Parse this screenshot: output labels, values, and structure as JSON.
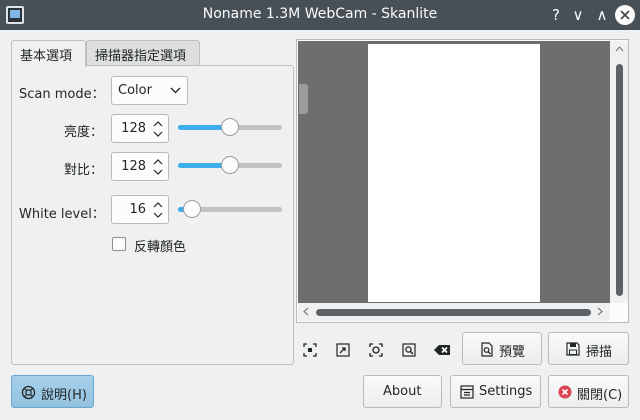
{
  "window": {
    "title": "Noname 1.3M WebCam - Skanlite",
    "help_glyph": "?",
    "minimize_glyph": "∨",
    "maximize_glyph": "∧"
  },
  "tabs": [
    {
      "label": "基本選項",
      "active": true
    },
    {
      "label": "掃描器指定選項",
      "active": false
    }
  ],
  "options": {
    "scan_mode": {
      "label": "Scan mode：",
      "value": "Color"
    },
    "brightness": {
      "label": "亮度：",
      "value": "128",
      "fraction": 0.5
    },
    "contrast": {
      "label": "對比：",
      "value": "128",
      "fraction": 0.5
    },
    "white_level": {
      "label": "White level：",
      "value": "16",
      "fraction": 0.06
    },
    "invert_colors": {
      "label": "反轉顏色",
      "checked": false
    }
  },
  "toolbar": {
    "preview_label": "預覽",
    "scan_label": "掃描"
  },
  "footer": {
    "help_label": "說明(H)",
    "about_label": "About",
    "settings_label": "Settings",
    "close_label": "關閉(C)"
  },
  "colors": {
    "accent": "#3daee9",
    "titlebar": "#475057",
    "preview_background": "#6e6e6e",
    "close_icon": "#da4453"
  }
}
